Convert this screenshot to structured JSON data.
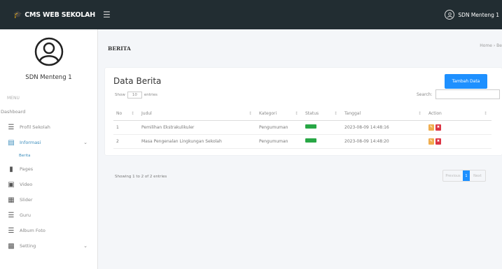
{
  "app": {
    "brand": "CMS WEB SEKOLAH",
    "user_name": "SDN Menteng 1"
  },
  "sidebar": {
    "profile_name": "SDN Menteng 1",
    "menu_header": "MENU",
    "items": [
      {
        "label": "Dashboard",
        "icon": "none"
      },
      {
        "label": "Profil Sekolah",
        "icon": "list-icon"
      },
      {
        "label": "Informasi",
        "icon": "list-icon",
        "active": true
      },
      {
        "label": "Pages",
        "icon": "file-icon"
      },
      {
        "label": "Video",
        "icon": "video-icon"
      },
      {
        "label": "Slider",
        "icon": "image-icon"
      },
      {
        "label": "Guru",
        "icon": "list-icon"
      },
      {
        "label": "Album Foto",
        "icon": "list-icon"
      },
      {
        "label": "Setting",
        "icon": "cog-icon"
      }
    ],
    "sub_items": [
      {
        "label": "Berita"
      }
    ]
  },
  "page": {
    "title": "BERITA",
    "breadcrumb": "Home › Be"
  },
  "card": {
    "title": "Data Berita",
    "add_button": "Tambah Data",
    "show_label": "Show",
    "show_value": "10",
    "entries_label": "entries",
    "search_label": "Search:",
    "columns": [
      "No",
      "Judul",
      "Kategori",
      "Status",
      "Tanggal",
      "Action"
    ],
    "rows": [
      {
        "no": "1",
        "judul": "Pemilihan Ekstrakulikuler",
        "kategori": "Pengumuman",
        "tanggal": "2023-08-09 14:48:16"
      },
      {
        "no": "2",
        "judul": "Masa Pengenalan Lingkungan Sekolah",
        "kategori": "Pengumuman",
        "tanggal": "2023-08-09 14:48:20"
      }
    ],
    "info": "Showing 1 to 2 of 2 entries",
    "pager": {
      "prev": "Previous",
      "current": "1",
      "next": "Next"
    }
  },
  "colors": {
    "topbar": "#222d32",
    "accent": "#1e90ff",
    "status_badge": "#28a745",
    "edit_button": "#f0ad4e",
    "delete_button": "#dc3545"
  }
}
